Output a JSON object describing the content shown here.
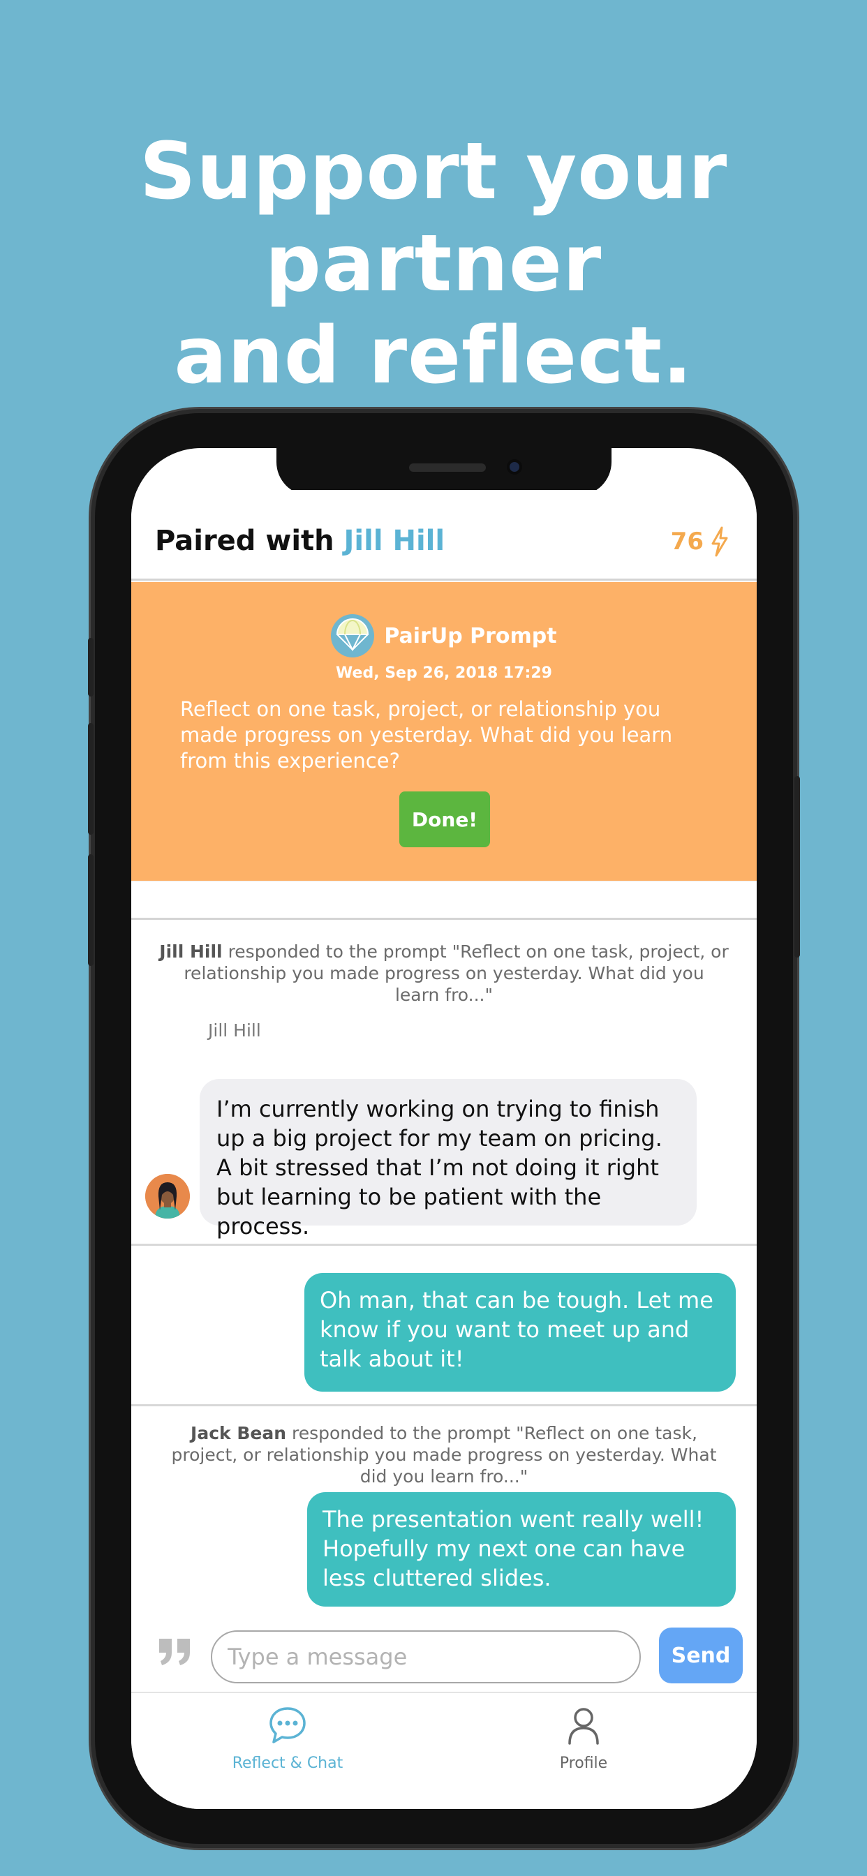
{
  "headline": {
    "line1": "Support your partner",
    "line2": "and reflect."
  },
  "header": {
    "prefix": "Paired with ",
    "partner": "Jill Hill",
    "score": "76"
  },
  "prompt": {
    "title": "PairUp Prompt",
    "date": "Wed, Sep 26, 2018 17:29",
    "text": "Reflect on one task, project, or relationship you made progress on yesterday. What did you learn from this experience?",
    "done_label": "Done!"
  },
  "chat": {
    "response1": {
      "name": "Jill Hill",
      "text": " responded to the prompt \"Reflect on one task, project, or relationship you made progress on yesterday. What did you learn fro...\""
    },
    "sender_label": "Jill Hill",
    "message_in": "I’m currently working on trying to finish up a big project for my team on pricing. A bit stressed that I’m not doing it right but learning to be patient with the process.",
    "message_out1": "Oh man, that can be tough. Let me know if you want to meet up and talk about it!",
    "response2": {
      "name": "Jack Bean",
      "text": " responded to the prompt \"Reflect on one task, project, or relationship you made progress on yesterday. What did you learn fro...\""
    },
    "message_out2": "The presentation went really well! Hopefully my next one can have less cluttered slides."
  },
  "composer": {
    "placeholder": "Type a message",
    "value": "",
    "send_label": "Send"
  },
  "tabs": [
    {
      "label": "Reflect & Chat",
      "icon": "chat-bubble-icon",
      "active": true
    },
    {
      "label": "Profile",
      "icon": "person-icon",
      "active": false
    }
  ],
  "colors": {
    "background": "#6fb6cf",
    "prompt": "#fdb167",
    "accent": "#5bb3d4",
    "outgoing": "#3fbfbf",
    "done": "#5cb63f",
    "send": "#64a6f5",
    "score": "#f4a94e"
  }
}
